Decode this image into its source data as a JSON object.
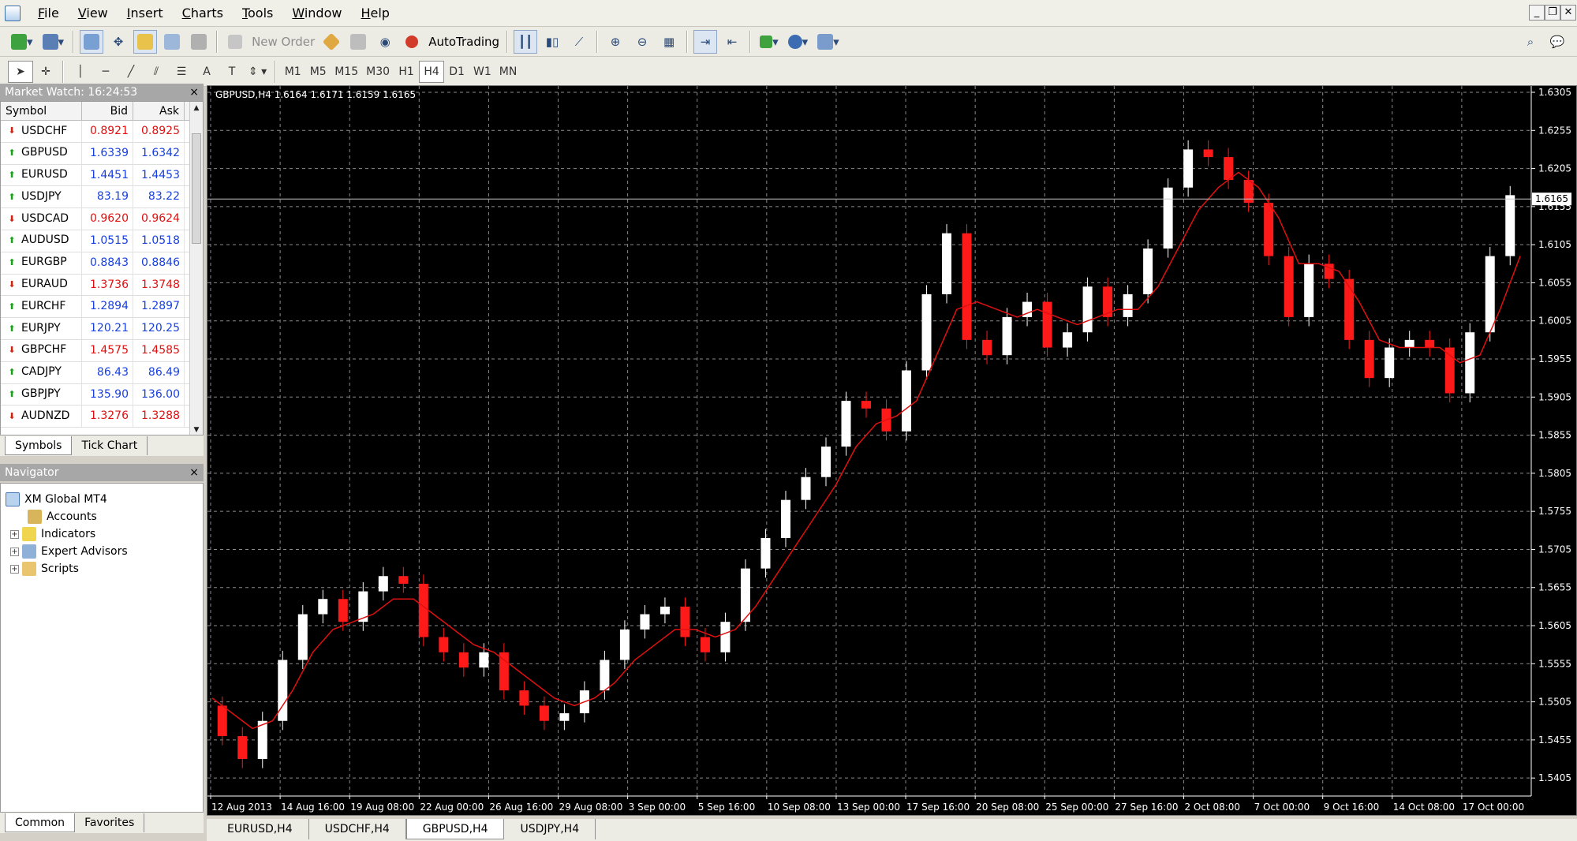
{
  "menu": [
    "File",
    "View",
    "Insert",
    "Charts",
    "Tools",
    "Window",
    "Help"
  ],
  "toolbar": {
    "new_order": "New Order",
    "autotrading": "AutoTrading",
    "timeframes": [
      "M1",
      "M5",
      "M15",
      "M30",
      "H1",
      "H4",
      "D1",
      "W1",
      "MN"
    ],
    "active_timeframe": "H4"
  },
  "market_watch": {
    "title": "Market Watch: 16:24:53",
    "columns": [
      "Symbol",
      "Bid",
      "Ask"
    ],
    "rows": [
      {
        "symbol": "USDCHF",
        "bid": "0.8921",
        "ask": "0.8925",
        "dir": "down"
      },
      {
        "symbol": "GBPUSD",
        "bid": "1.6339",
        "ask": "1.6342",
        "dir": "up"
      },
      {
        "symbol": "EURUSD",
        "bid": "1.4451",
        "ask": "1.4453",
        "dir": "up"
      },
      {
        "symbol": "USDJPY",
        "bid": "83.19",
        "ask": "83.22",
        "dir": "up"
      },
      {
        "symbol": "USDCAD",
        "bid": "0.9620",
        "ask": "0.9624",
        "dir": "down"
      },
      {
        "symbol": "AUDUSD",
        "bid": "1.0515",
        "ask": "1.0518",
        "dir": "up"
      },
      {
        "symbol": "EURGBP",
        "bid": "0.8843",
        "ask": "0.8846",
        "dir": "up"
      },
      {
        "symbol": "EURAUD",
        "bid": "1.3736",
        "ask": "1.3748",
        "dir": "down"
      },
      {
        "symbol": "EURCHF",
        "bid": "1.2894",
        "ask": "1.2897",
        "dir": "up"
      },
      {
        "symbol": "EURJPY",
        "bid": "120.21",
        "ask": "120.25",
        "dir": "up"
      },
      {
        "symbol": "GBPCHF",
        "bid": "1.4575",
        "ask": "1.4585",
        "dir": "down"
      },
      {
        "symbol": "CADJPY",
        "bid": "86.43",
        "ask": "86.49",
        "dir": "up"
      },
      {
        "symbol": "GBPJPY",
        "bid": "135.90",
        "ask": "136.00",
        "dir": "up"
      },
      {
        "symbol": "AUDNZD",
        "bid": "1.3276",
        "ask": "1.3288",
        "dir": "down"
      }
    ],
    "tabs": [
      "Symbols",
      "Tick Chart"
    ]
  },
  "navigator": {
    "title": "Navigator",
    "root": "XM Global MT4",
    "items": [
      "Accounts",
      "Indicators",
      "Expert Advisors",
      "Scripts"
    ],
    "tabs": [
      "Common",
      "Favorites"
    ]
  },
  "chart": {
    "header": "GBPUSD,H4  1.6164 1.6171 1.6159 1.6165",
    "tabs": [
      "EURUSD,H4",
      "USDCHF,H4",
      "GBPUSD,H4",
      "USDJPY,H4"
    ],
    "active_tab": "GBPUSD,H4"
  },
  "chart_data": {
    "type": "line",
    "symbol": "GBPUSD",
    "timeframe": "H4",
    "ohlc": {
      "open": 1.6164,
      "high": 1.6171,
      "low": 1.6159,
      "close": 1.6165
    },
    "current_price": "1.6165",
    "ylim": [
      1.54,
      1.6305
    ],
    "y_ticks": [
      "1.6305",
      "1.6255",
      "1.6205",
      "1.6155",
      "1.6105",
      "1.6055",
      "1.6005",
      "1.5955",
      "1.5905",
      "1.5855",
      "1.5805",
      "1.5755",
      "1.5705",
      "1.5655",
      "1.5605",
      "1.5555",
      "1.5505",
      "1.5455",
      "1.5405"
    ],
    "x_ticks": [
      "12 Aug 2013",
      "14 Aug 16:00",
      "19 Aug 08:00",
      "22 Aug 00:00",
      "26 Aug 16:00",
      "29 Aug 08:00",
      "3 Sep 00:00",
      "5 Sep 16:00",
      "10 Sep 08:00",
      "13 Sep 00:00",
      "17 Sep 16:00",
      "20 Sep 08:00",
      "25 Sep 00:00",
      "27 Sep 16:00",
      "2 Oct 08:00",
      "7 Oct 00:00",
      "9 Oct 16:00",
      "14 Oct 08:00",
      "17 Oct 00:00"
    ],
    "price": [
      1.55,
      1.546,
      1.543,
      1.548,
      1.556,
      1.562,
      1.564,
      1.561,
      1.565,
      1.567,
      1.566,
      1.559,
      1.557,
      1.555,
      1.557,
      1.552,
      1.55,
      1.548,
      1.549,
      1.552,
      1.556,
      1.56,
      1.562,
      1.563,
      1.559,
      1.557,
      1.561,
      1.568,
      1.572,
      1.577,
      1.58,
      1.584,
      1.59,
      1.589,
      1.586,
      1.594,
      1.604,
      1.612,
      1.598,
      1.596,
      1.601,
      1.603,
      1.597,
      1.599,
      1.605,
      1.601,
      1.604,
      1.61,
      1.618,
      1.623,
      1.622,
      1.619,
      1.616,
      1.609,
      1.601,
      1.608,
      1.606,
      1.598,
      1.593,
      1.597,
      1.598,
      1.597,
      1.591,
      1.599,
      1.609,
      1.617
    ],
    "ma": [
      1.551,
      1.549,
      1.547,
      1.548,
      1.552,
      1.557,
      1.56,
      1.561,
      1.562,
      1.564,
      1.564,
      1.562,
      1.56,
      1.558,
      1.557,
      1.555,
      1.553,
      1.551,
      1.55,
      1.551,
      1.553,
      1.556,
      1.558,
      1.56,
      1.56,
      1.559,
      1.56,
      1.563,
      1.567,
      1.571,
      1.575,
      1.579,
      1.584,
      1.587,
      1.588,
      1.59,
      1.596,
      1.602,
      1.603,
      1.602,
      1.601,
      1.602,
      1.601,
      1.6,
      1.601,
      1.602,
      1.602,
      1.605,
      1.61,
      1.615,
      1.618,
      1.62,
      1.618,
      1.614,
      1.608,
      1.608,
      1.607,
      1.603,
      1.598,
      1.597,
      1.597,
      1.597,
      1.595,
      1.596,
      1.602,
      1.609
    ]
  }
}
